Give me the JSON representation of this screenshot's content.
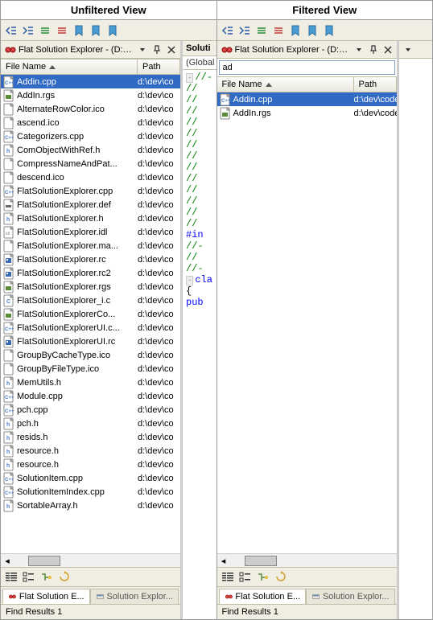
{
  "panes": [
    {
      "title": "Unfiltered View",
      "panel_title": "Flat Solution Explorer - (D:\\de...",
      "filter_visible": false,
      "filter_value": "",
      "code_tab": "Soluti",
      "code_global": "(Global S",
      "columns": {
        "filename": "File Name",
        "path": "Path"
      },
      "selected_index": 0,
      "rows": [
        {
          "icon": "cpp",
          "name": "Addin.cpp",
          "path": "d:\\dev\\co"
        },
        {
          "icon": "rgs",
          "name": "AddIn.rgs",
          "path": "d:\\dev\\co"
        },
        {
          "icon": "ico",
          "name": "AlternateRowColor.ico",
          "path": "d:\\dev\\co"
        },
        {
          "icon": "ico",
          "name": "ascend.ico",
          "path": "d:\\dev\\co"
        },
        {
          "icon": "cpp",
          "name": "Categorizers.cpp",
          "path": "d:\\dev\\co"
        },
        {
          "icon": "h",
          "name": "ComObjectWithRef.h",
          "path": "d:\\dev\\co"
        },
        {
          "icon": "txt",
          "name": "CompressNameAndPat...",
          "path": "d:\\dev\\co"
        },
        {
          "icon": "ico",
          "name": "descend.ico",
          "path": "d:\\dev\\co"
        },
        {
          "icon": "cpp",
          "name": "FlatSolutionExplorer.cpp",
          "path": "d:\\dev\\co"
        },
        {
          "icon": "def",
          "name": "FlatSolutionExplorer.def",
          "path": "d:\\dev\\co"
        },
        {
          "icon": "h",
          "name": "FlatSolutionExplorer.h",
          "path": "d:\\dev\\co"
        },
        {
          "icon": "idl",
          "name": "FlatSolutionExplorer.idl",
          "path": "d:\\dev\\co"
        },
        {
          "icon": "txt",
          "name": "FlatSolutionExplorer.ma...",
          "path": "d:\\dev\\co"
        },
        {
          "icon": "rc",
          "name": "FlatSolutionExplorer.rc",
          "path": "d:\\dev\\co"
        },
        {
          "icon": "rc",
          "name": "FlatSolutionExplorer.rc2",
          "path": "d:\\dev\\co"
        },
        {
          "icon": "rgs",
          "name": "FlatSolutionExplorer.rgs",
          "path": "d:\\dev\\co"
        },
        {
          "icon": "c",
          "name": "FlatSolutionExplorer_i.c",
          "path": "d:\\dev\\co"
        },
        {
          "icon": "rgs",
          "name": "FlatSolutionExplorerCo...",
          "path": "d:\\dev\\co"
        },
        {
          "icon": "cpp",
          "name": "FlatSolutionExplorerUI.c...",
          "path": "d:\\dev\\co"
        },
        {
          "icon": "rc",
          "name": "FlatSolutionExplorerUI.rc",
          "path": "d:\\dev\\co"
        },
        {
          "icon": "ico",
          "name": "GroupByCacheType.ico",
          "path": "d:\\dev\\co"
        },
        {
          "icon": "ico",
          "name": "GroupByFileType.ico",
          "path": "d:\\dev\\co"
        },
        {
          "icon": "h",
          "name": "MemUtils.h",
          "path": "d:\\dev\\co"
        },
        {
          "icon": "cpp",
          "name": "Module.cpp",
          "path": "d:\\dev\\co"
        },
        {
          "icon": "cpp",
          "name": "pch.cpp",
          "path": "d:\\dev\\co"
        },
        {
          "icon": "h",
          "name": "pch.h",
          "path": "d:\\dev\\co"
        },
        {
          "icon": "h",
          "name": "resids.h",
          "path": "d:\\dev\\co"
        },
        {
          "icon": "h",
          "name": "resource.h",
          "path": "d:\\dev\\co"
        },
        {
          "icon": "h",
          "name": "resource.h",
          "path": "d:\\dev\\co"
        },
        {
          "icon": "cpp",
          "name": "SolutionItem.cpp",
          "path": "d:\\dev\\co"
        },
        {
          "icon": "cpp",
          "name": "SolutionItemIndex.cpp",
          "path": "d:\\dev\\co"
        },
        {
          "icon": "h",
          "name": "SortableArray.h",
          "path": "d:\\dev\\co"
        }
      ],
      "bottom_tabs": [
        {
          "label": "Flat Solution E...",
          "active": true,
          "icon": "tool"
        },
        {
          "label": "Solution Explor...",
          "active": false,
          "icon": "sln"
        }
      ],
      "find": "Find Results 1"
    },
    {
      "title": "Filtered View",
      "panel_title": "Flat Solution Explorer - (D:\\de...",
      "filter_visible": true,
      "filter_value": "ad",
      "code_tab": "",
      "code_global": "",
      "columns": {
        "filename": "File Name",
        "path": "Path"
      },
      "selected_index": 0,
      "rows": [
        {
          "icon": "cpp",
          "name": "Addin.cpp",
          "path": "d:\\dev\\codep"
        },
        {
          "icon": "rgs",
          "name": "AddIn.rgs",
          "path": "d:\\dev\\codep"
        }
      ],
      "bottom_tabs": [
        {
          "label": "Flat Solution E...",
          "active": true,
          "icon": "tool"
        },
        {
          "label": "Solution Explor...",
          "active": false,
          "icon": "sln"
        }
      ],
      "find": "Find Results 1"
    }
  ],
  "code_lines": [
    {
      "cls": "cm",
      "txt": "//-"
    },
    {
      "cls": "cm",
      "txt": "//"
    },
    {
      "cls": "cm",
      "txt": "//"
    },
    {
      "cls": "cm",
      "txt": "//"
    },
    {
      "cls": "cm",
      "txt": "//"
    },
    {
      "cls": "cm",
      "txt": "//"
    },
    {
      "cls": "cm",
      "txt": "//"
    },
    {
      "cls": "cm",
      "txt": "//"
    },
    {
      "cls": "cm",
      "txt": "//"
    },
    {
      "cls": "cm",
      "txt": "//"
    },
    {
      "cls": "cm",
      "txt": "//"
    },
    {
      "cls": "cm",
      "txt": "//"
    },
    {
      "cls": "cm",
      "txt": "//"
    },
    {
      "cls": "cm",
      "txt": "//"
    },
    {
      "cls": "",
      "txt": ""
    },
    {
      "cls": "pp",
      "txt": "#in"
    },
    {
      "cls": "",
      "txt": ""
    },
    {
      "cls": "cm",
      "txt": "//-"
    },
    {
      "cls": "cm",
      "txt": "//"
    },
    {
      "cls": "cm",
      "txt": "//-"
    },
    {
      "cls": "",
      "txt": ""
    },
    {
      "cls": "kw",
      "txt": "cla"
    },
    {
      "cls": "",
      "txt": ""
    },
    {
      "cls": "",
      "txt": ""
    },
    {
      "cls": "",
      "txt": "{"
    },
    {
      "cls": "kw",
      "txt": "pub"
    }
  ]
}
